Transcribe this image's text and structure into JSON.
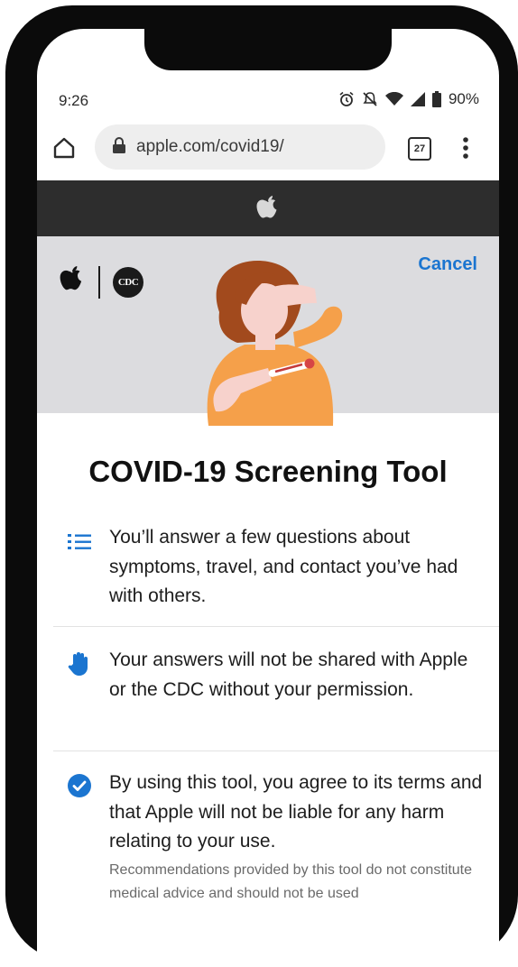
{
  "status_bar": {
    "time": "9:26",
    "battery": "90%"
  },
  "browser": {
    "url": "apple.com/covid19/",
    "tab_count": "27"
  },
  "hero": {
    "cancel_label": "Cancel",
    "cdc_label": "CDC"
  },
  "page": {
    "title": "COVID-19 Screening Tool",
    "items": [
      {
        "icon": "numbered-list-icon",
        "text": "You’ll answer a few questions about symptoms, travel, and contact you’ve had with others."
      },
      {
        "icon": "hand-icon",
        "text": "Your answers will not be shared with Apple or the CDC without your permission."
      },
      {
        "icon": "checkmark-circle-icon",
        "text": "By using this tool, you agree to its terms and that Apple will not be liable for any harm relating to your use."
      }
    ],
    "fine_print": "Recommendations provided by this tool do not constitute medical advice and should not be used"
  },
  "colors": {
    "accent": "#1b75d0",
    "hero_bg": "#dcdcdf",
    "nav_bg": "#2d2d2d"
  }
}
